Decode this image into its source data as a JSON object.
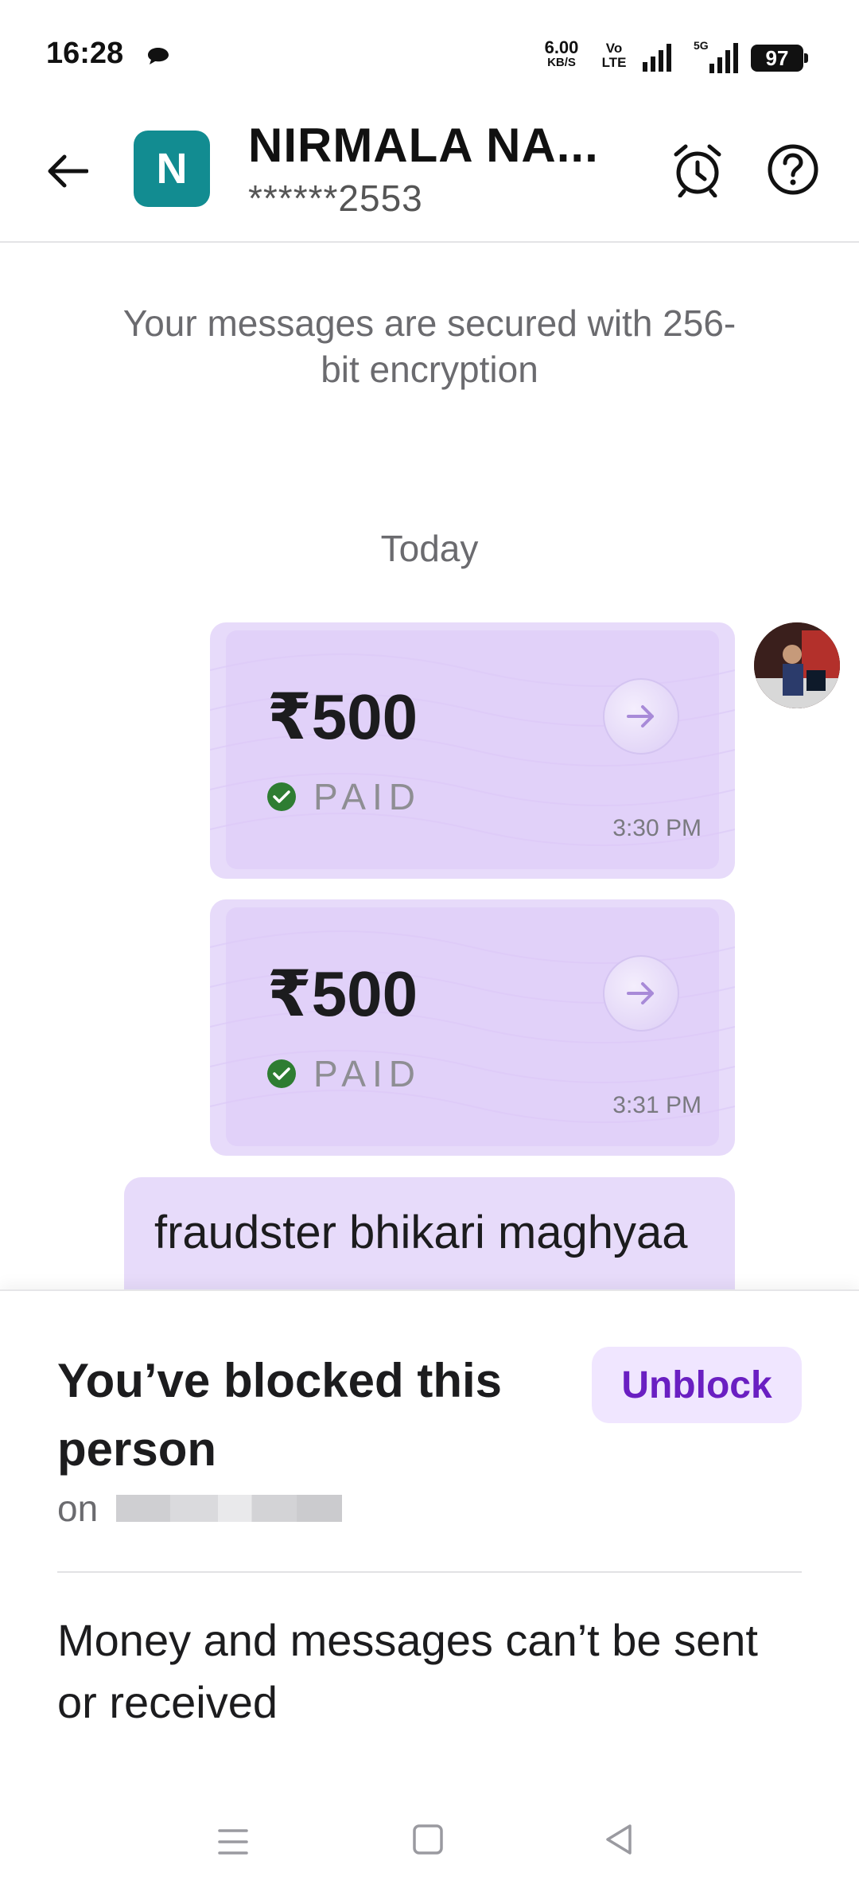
{
  "status_bar": {
    "time": "16:28",
    "net_speed": "6.00",
    "net_unit": "KB/S",
    "volte": "Vo",
    "lte": "LTE",
    "network_5g": "5G",
    "battery": "97",
    "icons": [
      "chat-bubble-icon",
      "signal-icon",
      "signal-5g-icon",
      "battery-icon"
    ]
  },
  "header": {
    "avatar_letter": "N",
    "contact_name": "NIRMALA  NA...",
    "contact_number": "******2553",
    "avatar_color": "#128c91",
    "icons": [
      "back-arrow-icon",
      "alarm-clock-icon",
      "help-icon"
    ]
  },
  "chat": {
    "security_note": "Your messages are secured with 256-bit encryption",
    "date_label": "Today",
    "payments": [
      {
        "amount": "₹500",
        "status": "PAID",
        "time": "3:30 PM"
      },
      {
        "amount": "₹500",
        "status": "PAID",
        "time": "3:31 PM"
      }
    ],
    "message_text": "fraudster bhikari maghyaa",
    "bubble_color": "#e7dbfa",
    "paid_check_color": "#2e7d32"
  },
  "blocked": {
    "title": "You’ve blocked this person",
    "on_label": "on",
    "unblock_label": "Unblock",
    "info": "Money and messages can’t be sent or received",
    "accent_color": "#6a1fc2"
  },
  "nav_bar": {
    "icons": [
      "menu-icon",
      "home-square-icon",
      "back-triangle-icon"
    ]
  }
}
